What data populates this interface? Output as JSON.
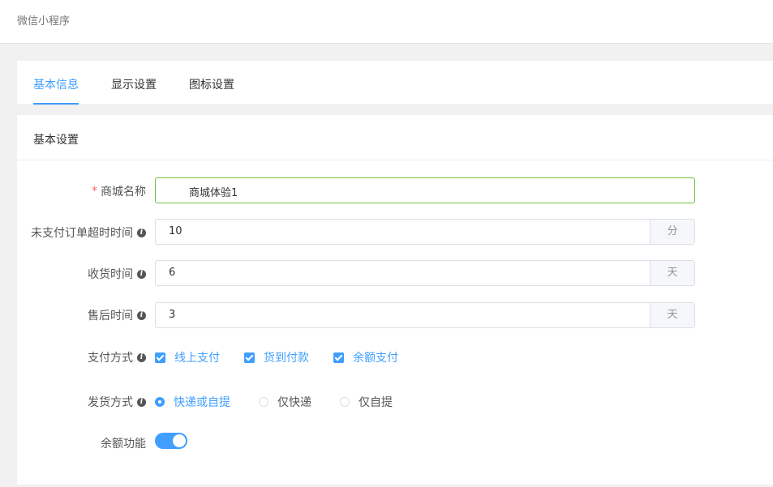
{
  "header": {
    "title": "微信小程序"
  },
  "tabs": [
    {
      "label": "基本信息",
      "active": true
    },
    {
      "label": "显示设置",
      "active": false
    },
    {
      "label": "图标设置",
      "active": false
    }
  ],
  "section": {
    "title": "基本设置"
  },
  "form": {
    "shop_name": {
      "label": "商城名称",
      "required_mark": "*",
      "value": "商城体验1"
    },
    "unpaid_timeout": {
      "label": "未支付订单超时时间",
      "value": "10",
      "unit": "分",
      "info_icon": "info-icon"
    },
    "receive_time": {
      "label": "收货时间",
      "value": "6",
      "unit": "天",
      "info_icon": "info-icon"
    },
    "after_sale_time": {
      "label": "售后时间",
      "value": "3",
      "unit": "天",
      "info_icon": "info-icon"
    },
    "payment": {
      "label": "支付方式",
      "options": [
        {
          "label": "线上支付",
          "checked": true
        },
        {
          "label": "货到付款",
          "checked": true
        },
        {
          "label": "余额支付",
          "checked": true
        }
      ]
    },
    "delivery": {
      "label": "发货方式",
      "options": [
        {
          "label": "快递或自提",
          "selected": true
        },
        {
          "label": "仅快递",
          "selected": false
        },
        {
          "label": "仅自提",
          "selected": false
        }
      ]
    },
    "balance": {
      "label": "余额功能",
      "enabled": true
    }
  },
  "colors": {
    "accent": "#409eff",
    "required": "#f56c6c",
    "valid_border": "#67c23a"
  }
}
